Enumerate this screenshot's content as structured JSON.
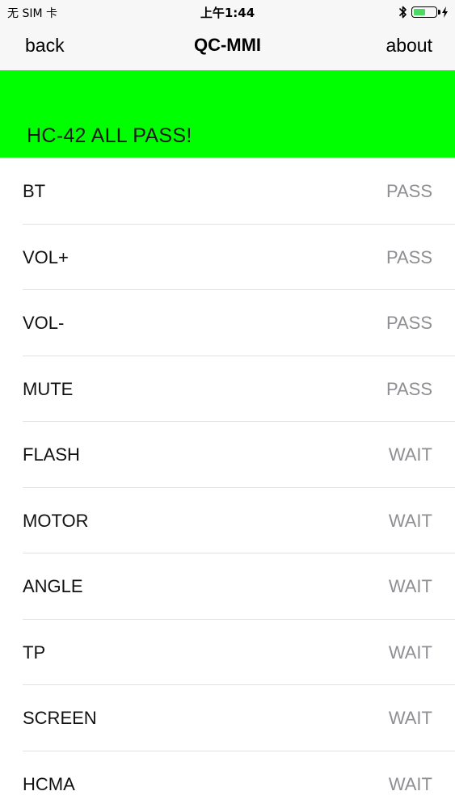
{
  "status_bar": {
    "carrier": "无 SIM 卡",
    "time": "上午1:44",
    "bluetooth_icon": "bluetooth-icon",
    "battery_icon": "battery-icon",
    "charging_icon": "charging-bolt-icon",
    "battery_level": 0.55,
    "battery_color": "#4cd964"
  },
  "nav": {
    "back_label": "back",
    "title": "QC-MMI",
    "about_label": "about"
  },
  "result": {
    "text": "HC-42 ALL PASS!",
    "color": "#00ff00"
  },
  "tests": [
    {
      "name": "BT",
      "status": "PASS"
    },
    {
      "name": "VOL+",
      "status": "PASS"
    },
    {
      "name": "VOL-",
      "status": "PASS"
    },
    {
      "name": "MUTE",
      "status": "PASS"
    },
    {
      "name": "FLASH",
      "status": "WAIT"
    },
    {
      "name": "MOTOR",
      "status": "WAIT"
    },
    {
      "name": "ANGLE",
      "status": "WAIT"
    },
    {
      "name": "TP",
      "status": "WAIT"
    },
    {
      "name": "SCREEN",
      "status": "WAIT"
    },
    {
      "name": "HCMA",
      "status": "WAIT"
    }
  ]
}
